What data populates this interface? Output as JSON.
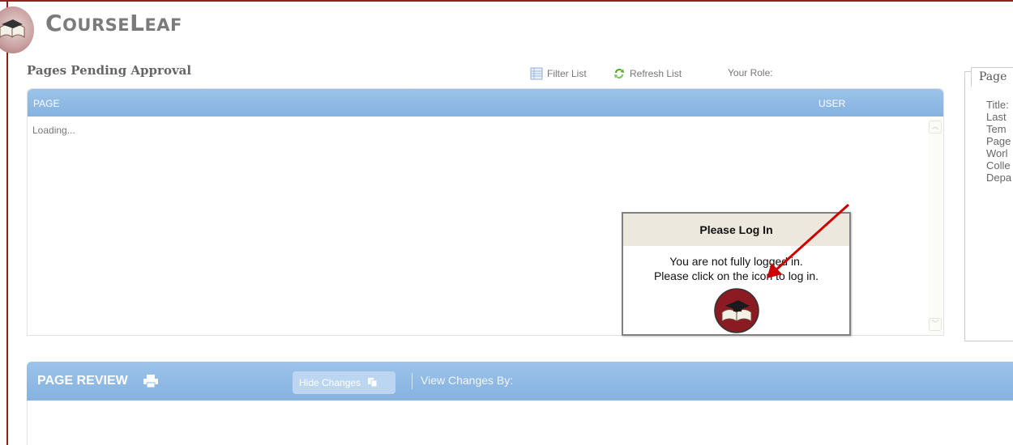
{
  "brand": {
    "part1_big": "C",
    "part1_small": "OURSE",
    "part2_big": "L",
    "part2_small": "EAF"
  },
  "pending": {
    "title": "Pages Pending Approval",
    "filter_label": "Filter List",
    "refresh_label": "Refresh List",
    "role_label": "Your Role:",
    "columns": {
      "page": "PAGE",
      "user": "USER"
    },
    "loading_text": "Loading..."
  },
  "side_panel": {
    "tab_label": "Page",
    "fields": [
      "Title:",
      "Last",
      "Tem",
      "Page",
      "Worl",
      "Colle",
      "Depa"
    ]
  },
  "login_modal": {
    "title": "Please Log In",
    "line1": "You are not fully logged in.",
    "line2": "Please click on the icon to log in."
  },
  "page_review": {
    "title": "PAGE REVIEW",
    "hide_changes": "Hide Changes",
    "view_changes_by": "View Changes By:"
  },
  "colors": {
    "frame": "#9b1b1e",
    "header_blue": "#8fb9e4",
    "modal_head": "#ece8de",
    "arrow": "#cc0000"
  },
  "icons": [
    "courseleaf-logo-icon",
    "filter-list-icon",
    "refresh-icon",
    "print-icon",
    "hide-changes-icon",
    "login-icon"
  ]
}
